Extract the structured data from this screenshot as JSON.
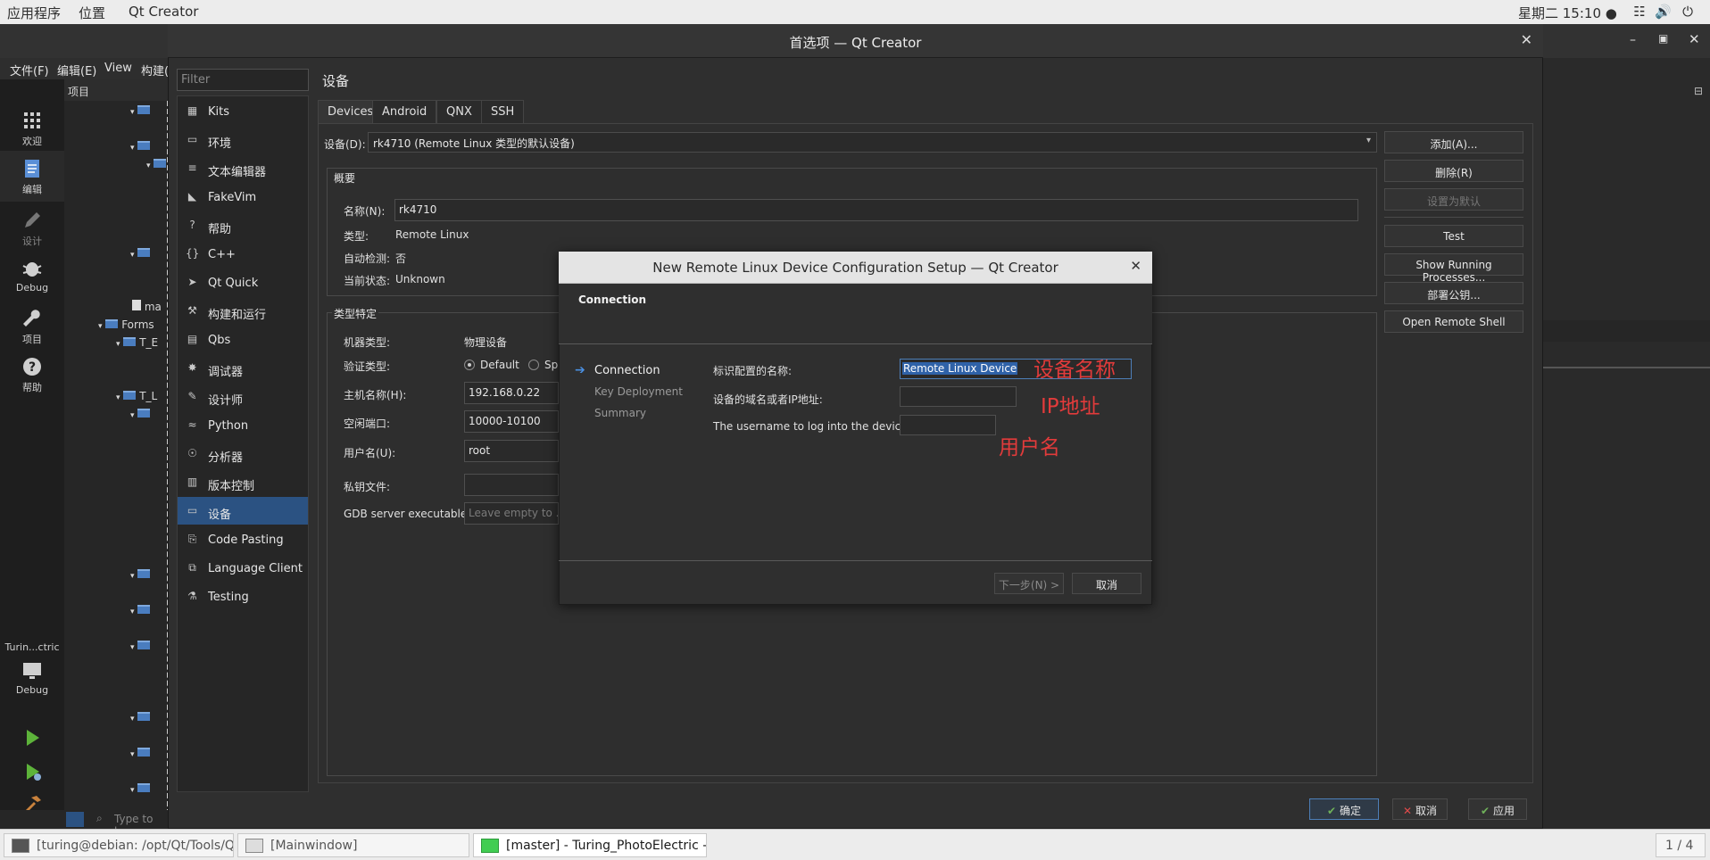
{
  "topbar": {
    "apps": "应用程序",
    "places": "位置",
    "app_name": "Qt Creator",
    "clock": "星期二 15:10 ●"
  },
  "main": {
    "menus": [
      "文件(F)",
      "编辑(E)",
      "View",
      "构建("
    ],
    "project_header": "项目",
    "modes": [
      "欢迎",
      "编辑",
      "设计",
      "Debug",
      "项目",
      "帮助"
    ],
    "kit_label": "Turin...ctric",
    "kit_mode": "Debug",
    "tree": [
      "ma",
      "Forms",
      "T_E",
      "T_L"
    ],
    "locator_placeholder": "Type to loc"
  },
  "preferences": {
    "title": "首选项 — Qt Creator",
    "filter_placeholder": "Filter",
    "categories": [
      "Kits",
      "环境",
      "文本编辑器",
      "FakeVim",
      "帮助",
      "C++",
      "Qt Quick",
      "构建和运行",
      "Qbs",
      "调试器",
      "设计师",
      "Python",
      "分析器",
      "版本控制",
      "设备",
      "Code Pasting",
      "Language Client",
      "Testing"
    ],
    "page_title": "设备",
    "tabs": [
      "Devices",
      "Android",
      "QNX",
      "SSH"
    ],
    "device_label": "设备(D):",
    "device_value": "rk4710 (Remote Linux 类型的默认设备)",
    "side_buttons": [
      "添加(A)...",
      "删除(R)",
      "设置为默认",
      "Test",
      "Show Running Processes...",
      "部署公钥...",
      "Open Remote Shell"
    ],
    "overview": {
      "title": "概要",
      "name_label": "名称(N):",
      "name_value": "rk4710",
      "type_label": "类型:",
      "type_value": "Remote Linux",
      "autodetect_label": "自动检测:",
      "autodetect_value": "否",
      "state_label": "当前状态:",
      "state_value": "Unknown"
    },
    "specific": {
      "title": "类型特定",
      "machine_type_label": "机器类型:",
      "machine_type_value": "物理设备",
      "auth_label": "验证类型:",
      "auth_default": "Default",
      "auth_other": "Sp",
      "host_label": "主机名称(H):",
      "host_value": "192.168.0.22",
      "ports_label": "空闲端口:",
      "ports_value": "10000-10100",
      "user_label": "用户名(U):",
      "user_value": "root",
      "key_label": "私钥文件:",
      "gdb_label": "GDB server executable:",
      "gdb_placeholder": "Leave empty to ..."
    },
    "ok": "确定",
    "cancel": "取消",
    "apply": "应用"
  },
  "wizard": {
    "title": "New Remote Linux Device Configuration Setup — Qt Creator",
    "header": "Connection",
    "steps": [
      "Connection",
      "Key Deployment",
      "Summary"
    ],
    "name_label": "标识配置的名称:",
    "name_value": "Remote Linux Device",
    "host_label": "设备的域名或者IP地址:",
    "user_label": "The username to log into the device:",
    "next": "下一步(N) >",
    "cancel": "取消"
  },
  "annotations": {
    "name": "设备名称",
    "ip": "IP地址",
    "user": "用户名",
    "color": "#e23b3b"
  },
  "taskbar": {
    "tasks": [
      "[turing@debian: /opt/Qt/Tools/Qt...",
      "[Mainwindow]",
      "[master] - Turing_PhotoElectric - ..."
    ],
    "workspace": "1 / 4"
  }
}
